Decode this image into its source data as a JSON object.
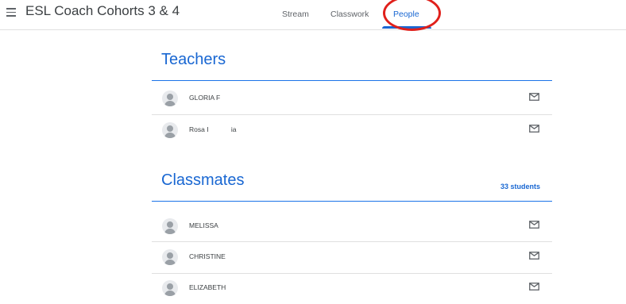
{
  "header": {
    "title": "ESL Coach Cohorts 3 & 4",
    "tabs": [
      {
        "label": "Stream"
      },
      {
        "label": "Classwork"
      },
      {
        "label": "People"
      }
    ]
  },
  "teachers": {
    "title": "Teachers",
    "people": [
      {
        "name": "GLORIA F"
      },
      {
        "name": "Rosa I            ia"
      }
    ]
  },
  "classmates": {
    "title": "Classmates",
    "count": "33 students",
    "people": [
      {
        "name": "MELISSA"
      },
      {
        "name": "CHRISTINE"
      },
      {
        "name": "ELIZABETH"
      }
    ]
  },
  "colors": {
    "accent": "#1967d2",
    "annotation_circle": "#e0201b"
  },
  "icons": [
    "menu-icon",
    "avatar-icon",
    "email-icon"
  ]
}
